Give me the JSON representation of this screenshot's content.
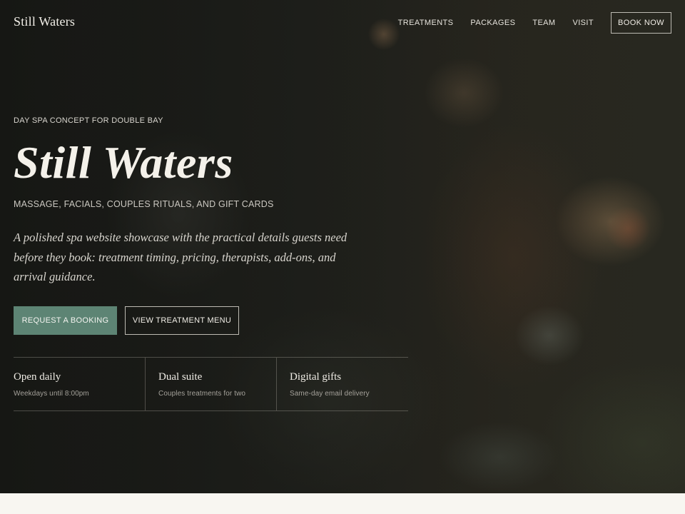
{
  "header": {
    "brand": "Still Waters",
    "nav": [
      "TREATMENTS",
      "PACKAGES",
      "TEAM",
      "VISIT"
    ],
    "book_button": "BOOK NOW"
  },
  "hero": {
    "eyebrow": "DAY SPA CONCEPT FOR DOUBLE BAY",
    "title": "Still Waters",
    "services": "MASSAGE, FACIALS, COUPLES RITUALS, AND GIFT CARDS",
    "intro": "A polished spa website showcase with the practical details guests need before they book: treatment timing, pricing, therapists, add-ons, and arrival guidance.",
    "primary_button": "REQUEST A BOOKING",
    "secondary_button": "VIEW TREATMENT MENU",
    "features": [
      {
        "title": "Open daily",
        "subtitle": "Weekdays until 8:00pm"
      },
      {
        "title": "Dual suite",
        "subtitle": "Couples treatments for two"
      },
      {
        "title": "Digital gifts",
        "subtitle": "Same-day email delivery"
      }
    ]
  },
  "colors": {
    "accent": "#5d8474",
    "hero_background": "#191a17",
    "page_background": "#f8f6f1"
  }
}
